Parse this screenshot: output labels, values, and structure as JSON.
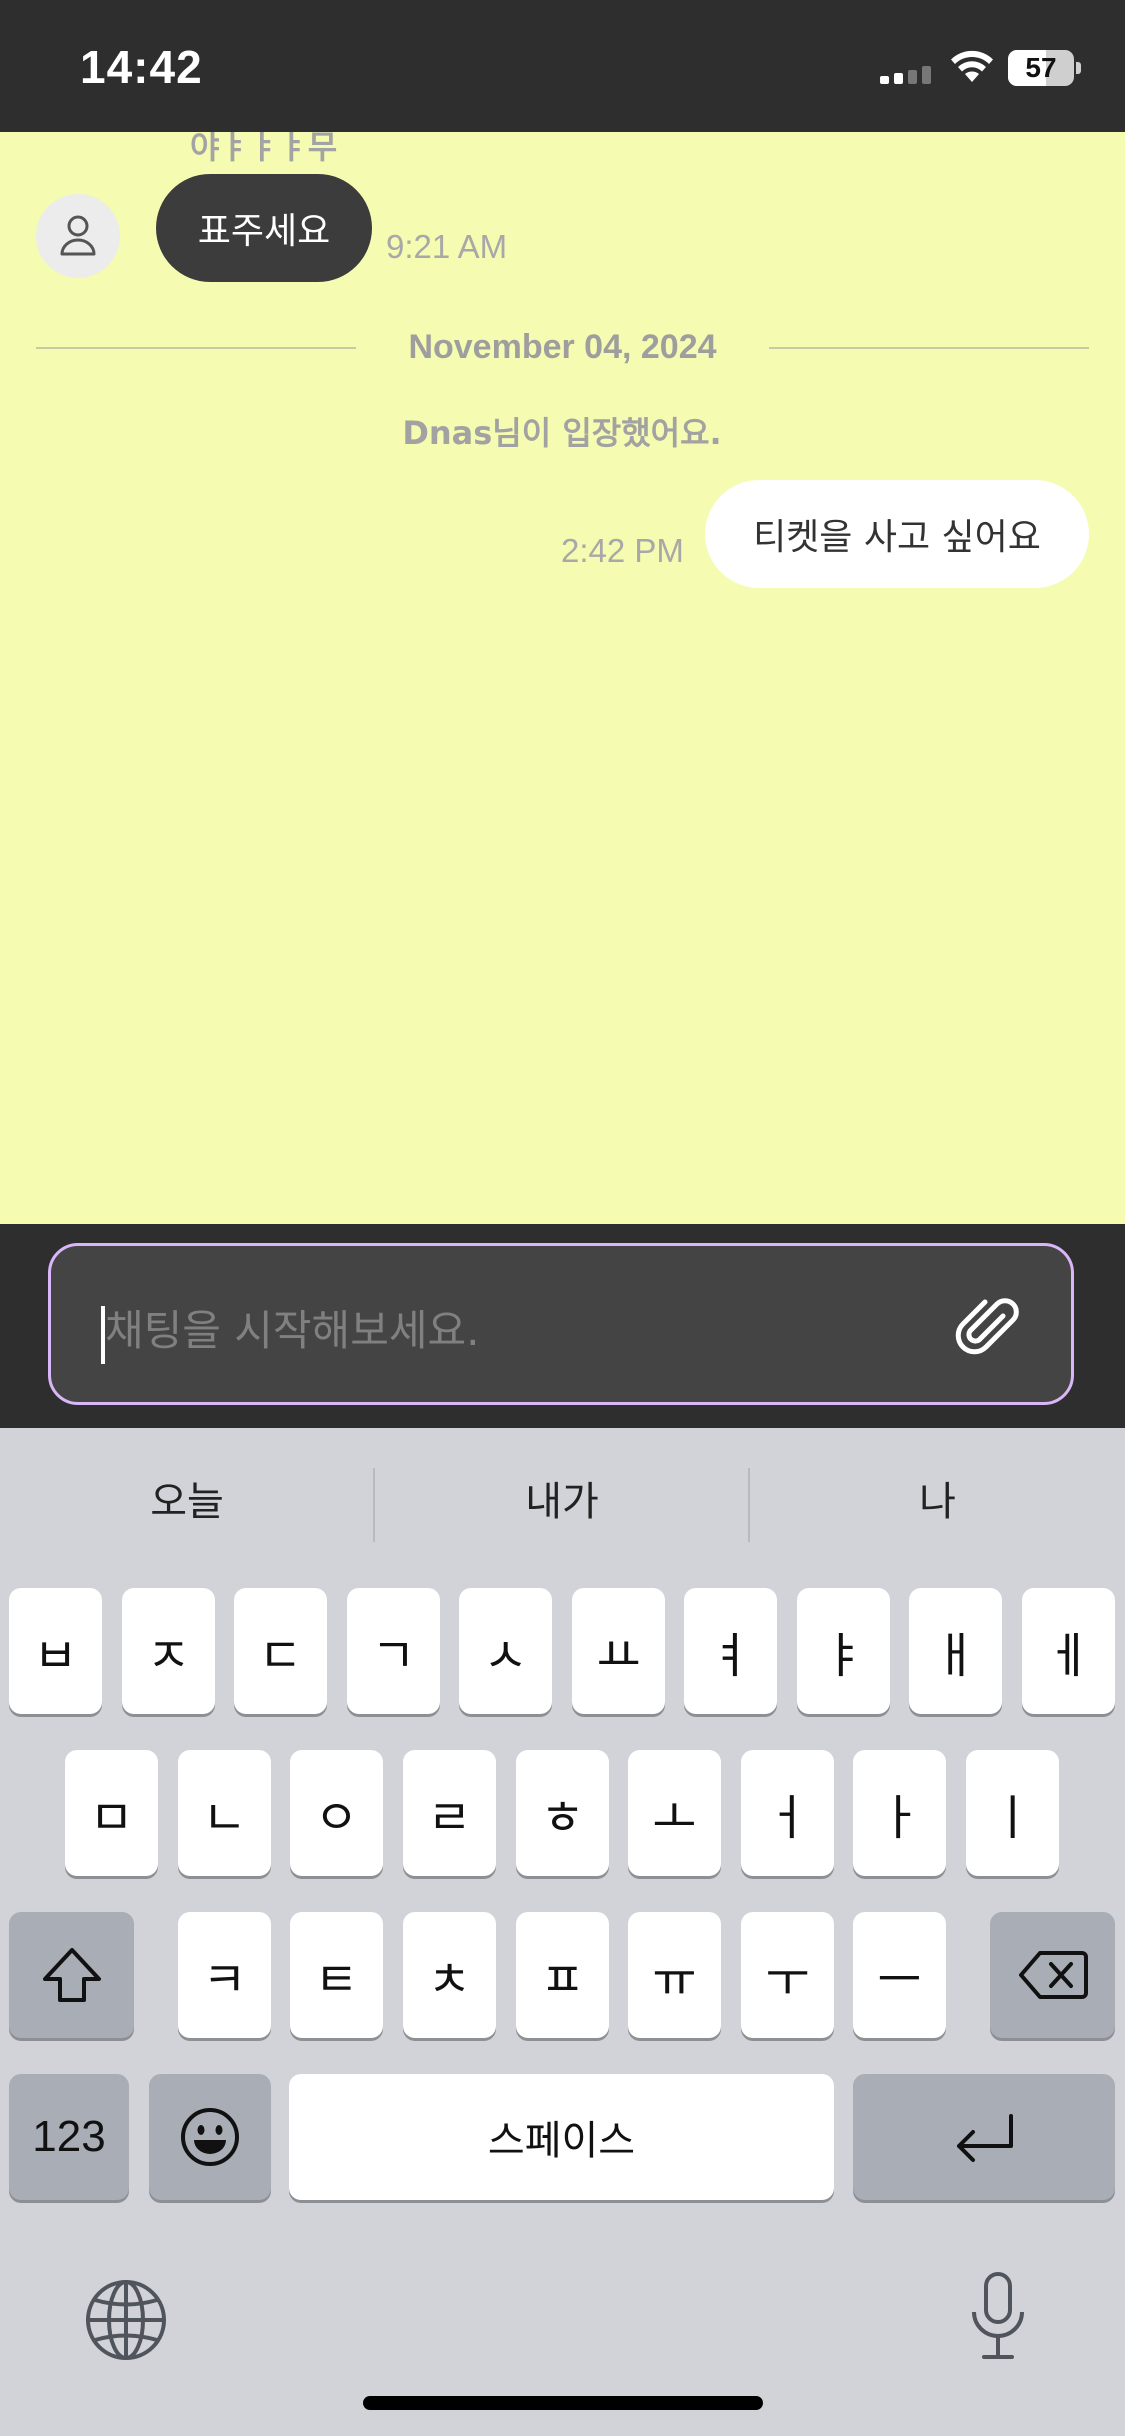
{
  "status_bar": {
    "time": "14:42",
    "battery_text": "57",
    "battery_level": 0.57,
    "icons": [
      "signal-icon",
      "wifi-icon",
      "battery-icon"
    ]
  },
  "chat": {
    "cut_text": "야ㅑㅑㅑ무",
    "messages": [
      {
        "sender": "other",
        "text": "표주세요",
        "time": "9:21 AM"
      },
      {
        "sender": "me",
        "text": "티켓을 사고 싶어요",
        "time": "2:42 PM"
      }
    ],
    "date_divider": "November 04, 2024",
    "system_message": "Dnas님이 입장했어요."
  },
  "input": {
    "placeholder": "채팅을 시작해보세요.",
    "value": "",
    "attach_icon": "paperclip-icon",
    "border_color": "#d9b6f7"
  },
  "keyboard": {
    "suggestions": [
      "오늘",
      "내가",
      "나"
    ],
    "row1": [
      "ㅂ",
      "ㅈ",
      "ㄷ",
      "ㄱ",
      "ㅅ",
      "ㅛ",
      "ㅕ",
      "ㅑ",
      "ㅐ",
      "ㅔ"
    ],
    "row2": [
      "ㅁ",
      "ㄴ",
      "ㅇ",
      "ㄹ",
      "ㅎ",
      "ㅗ",
      "ㅓ",
      "ㅏ",
      "ㅣ"
    ],
    "row3": [
      "ㅋ",
      "ㅌ",
      "ㅊ",
      "ㅍ",
      "ㅠ",
      "ㅜ",
      "ㅡ"
    ],
    "numbers_label": "123",
    "space_label": "스페이스",
    "icons": [
      "shift-icon",
      "backspace-icon",
      "emoji-icon",
      "return-icon",
      "globe-icon",
      "microphone-icon"
    ]
  },
  "colors": {
    "chat_background": "#f5fbb0",
    "bar_background": "#2e2e2e",
    "incoming_bubble": "#3c3c3c",
    "outgoing_bubble": "#ffffff",
    "keyboard_background": "#d1d3d9"
  }
}
